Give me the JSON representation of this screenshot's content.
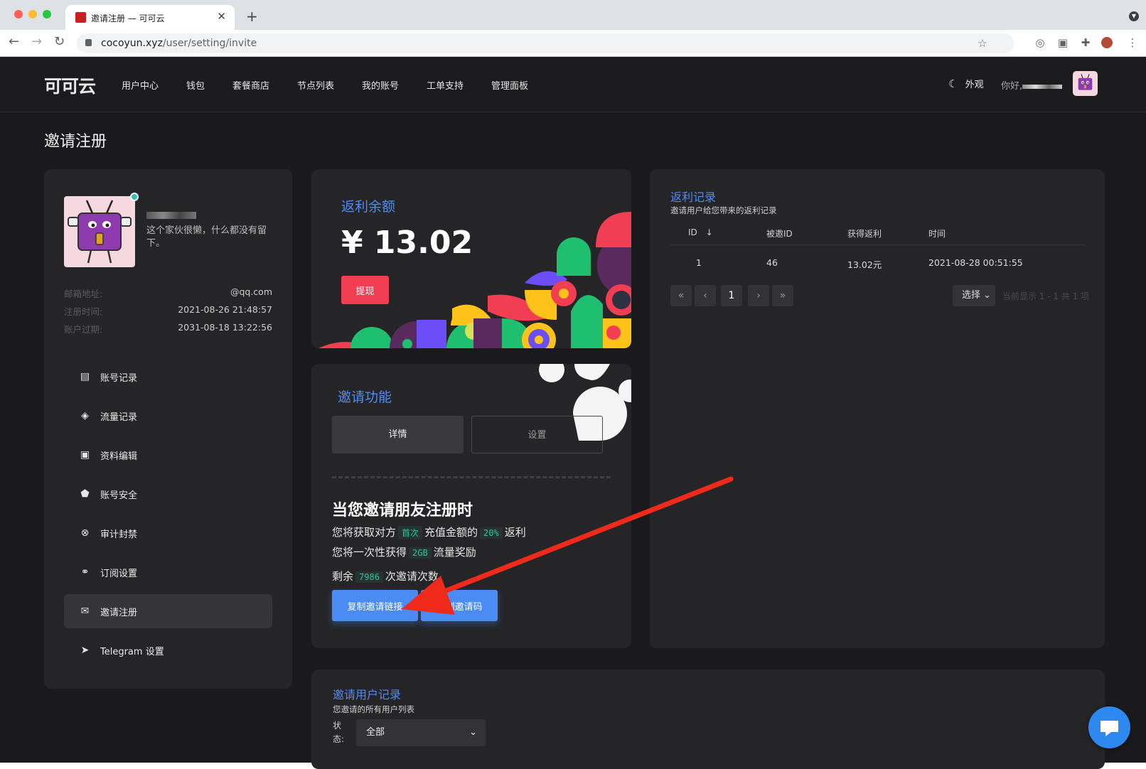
{
  "browser": {
    "tab_title": "邀请注册 — 可可云",
    "url_host": "cocoyun.xyz",
    "url_path": "/user/setting/invite"
  },
  "nav": {
    "logo": "可可云",
    "items": [
      "用户中心",
      "钱包",
      "套餐商店",
      "节点列表",
      "我的账号",
      "工单支持",
      "管理面板"
    ],
    "appearance": "外观",
    "greeting": "你好,"
  },
  "page_title": "邀请注册",
  "profile": {
    "bio": "这个家伙很懒，什么都没有留下。",
    "email_label": "邮箱地址:",
    "email_value": "@qq.com",
    "register_label": "注册时间:",
    "register_value": "2021-08-26 21:48:57",
    "expire_label": "账户过期:",
    "expire_value": "2031-08-18 13:22:56",
    "menu": [
      {
        "label": "账号记录",
        "icon": "document-icon"
      },
      {
        "label": "流量记录",
        "icon": "paint-bucket-icon"
      },
      {
        "label": "资料编辑",
        "icon": "user-card-icon"
      },
      {
        "label": "账号安全",
        "icon": "shield-lock-icon"
      },
      {
        "label": "审计封禁",
        "icon": "block-icon"
      },
      {
        "label": "订阅设置",
        "icon": "link-icon"
      },
      {
        "label": "邀请注册",
        "icon": "envelope-icon",
        "active": true
      },
      {
        "label": "Telegram 设置",
        "icon": "send-icon"
      }
    ]
  },
  "balance": {
    "label": "返利余额",
    "amount": "¥ 13.02",
    "withdraw": "提现"
  },
  "invite": {
    "title": "邀请功能",
    "tab_detail": "详情",
    "tab_settings": "设置",
    "heading": "当您邀请朋友注册时",
    "line1_a": "您将获取对方",
    "line1_code1": "首次",
    "line1_b": "充值金额的",
    "line1_code2": "20%",
    "line1_c": "返利",
    "line2_a": "您将一次性获得",
    "line2_code": "2GB",
    "line2_b": "流量奖励",
    "line3_a": "剩余",
    "line3_code": "7986",
    "line3_b": "次邀请次数",
    "copy_link": "复制邀请链接",
    "copy_code": "复制邀请码"
  },
  "rebate": {
    "title": "返利记录",
    "subtitle": "邀请用户给您带来的返利记录",
    "headers": [
      "ID",
      "被邀ID",
      "获得返利",
      "时间"
    ],
    "rows": [
      [
        "1",
        "46",
        "13.02元",
        "2021-08-28 00:51:55"
      ]
    ],
    "page": "1",
    "select": "选择",
    "page_info": "当前显示 1 - 1 共 1 项"
  },
  "records": {
    "title": "邀请用户记录",
    "subtitle": "您邀请的所有用户列表",
    "status_label": "状态:",
    "status_value": "全部"
  },
  "colors": {
    "accent_blue": "#4a8bf4",
    "danger_red": "#f23e52",
    "code_green": "#2fc3a2",
    "background": "#1a1a1c",
    "card": "#252527"
  }
}
